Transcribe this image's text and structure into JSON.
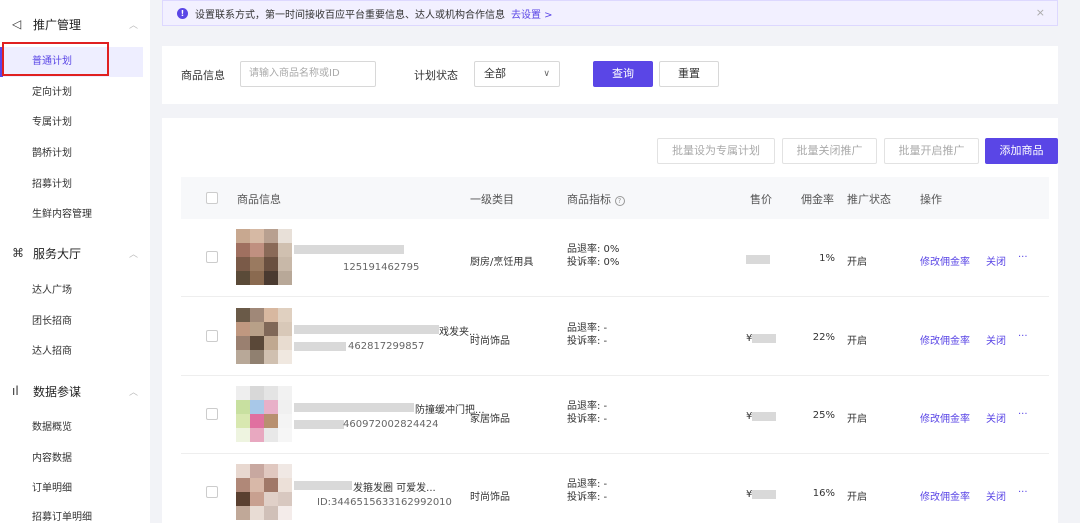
{
  "sidebar": {
    "groups": [
      {
        "label": "推广管理",
        "icon": "megaphone-icon",
        "glyph": "◁",
        "items": [
          "普通计划",
          "定向计划",
          "专属计划",
          "鹊桥计划",
          "招募计划",
          "生鲜内容管理"
        ]
      },
      {
        "label": "服务大厅",
        "icon": "service-icon",
        "glyph": "⌘",
        "items": [
          "达人广场",
          "团长招商",
          "达人招商"
        ]
      },
      {
        "label": "数据参谋",
        "icon": "chart-icon",
        "glyph": "ıl",
        "items": [
          "数据概览",
          "内容数据",
          "订单明细",
          "招募订单明细"
        ]
      }
    ],
    "active_item": "普通计划"
  },
  "notice": {
    "text": "设置联系方式，第一时间接收百应平台重要信息、达人或机构合作信息",
    "link": "去设置 >",
    "close": "×"
  },
  "filter": {
    "product_label": "商品信息",
    "product_placeholder": "请输入商品名称或ID",
    "status_label": "计划状态",
    "status_value": "全部",
    "query_button": "查询",
    "reset_button": "重置"
  },
  "toolbar": {
    "set_exclusive": "批量设为专属计划",
    "batch_close": "批量关闭推广",
    "batch_open": "批量开启推广",
    "add_product": "添加商品"
  },
  "table": {
    "headers": {
      "product": "商品信息",
      "category": "一级类目",
      "metrics": "商品指标",
      "price": "售价",
      "commission": "佣金率",
      "status": "推广状态",
      "actions": "操作"
    },
    "rows": [
      {
        "title": "",
        "id": "125191462795",
        "category": "厨房/烹饪用具",
        "refund": "品退率: 0%",
        "complaint": "投诉率: 0%",
        "price": "",
        "commission": "1%",
        "status": "开启",
        "edit": "修改佣金率",
        "close": "关闭",
        "more": "···"
      },
      {
        "title": "戏发夹...",
        "id": "462817299857",
        "category": "时尚饰品",
        "refund": "品退率: -",
        "complaint": "投诉率: -",
        "price": "¥",
        "commission": "22%",
        "status": "开启",
        "edit": "修改佣金率",
        "close": "关闭",
        "more": "···"
      },
      {
        "title": "防撞缓冲门把...",
        "id": "46097200282442​4",
        "category": "家居饰品",
        "refund": "品退率: -",
        "complaint": "投诉率: -",
        "price": "¥",
        "commission": "25%",
        "status": "开启",
        "edit": "修改佣金率",
        "close": "关闭",
        "more": "···"
      },
      {
        "title": "发箍发圈 可爱发...",
        "id": "ID:3446515633162992010",
        "category": "时尚饰品",
        "refund": "品退率: -",
        "complaint": "投诉率: -",
        "price": "¥",
        "commission": "16%",
        "status": "开启",
        "edit": "修改佣金率",
        "close": "关闭",
        "more": "···"
      }
    ]
  },
  "colors": {
    "accent": "#5a46e6",
    "highlight": "#e02020"
  }
}
